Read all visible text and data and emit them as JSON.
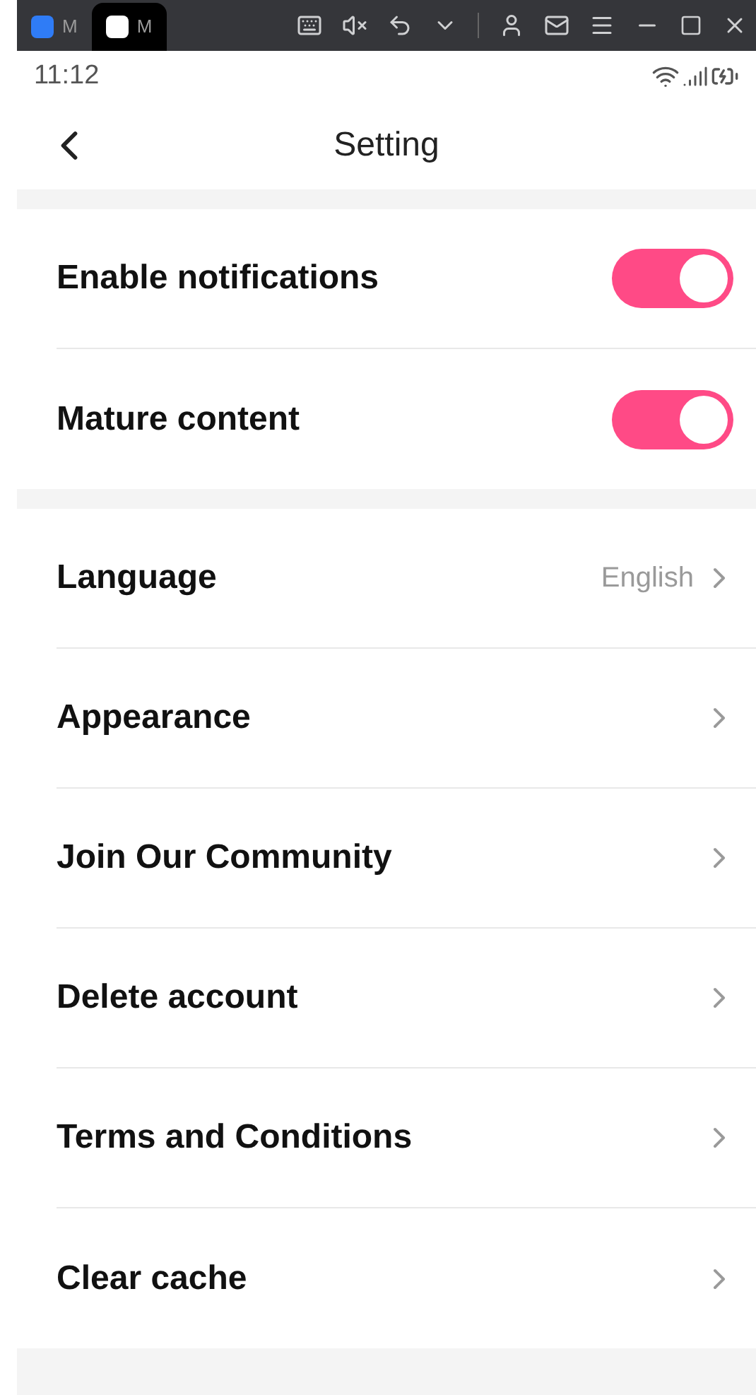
{
  "window_tabs": [
    {
      "label": "M",
      "selected": false
    },
    {
      "label": "M",
      "selected": true
    }
  ],
  "status_bar": {
    "time": "11:12"
  },
  "header": {
    "title": "Setting"
  },
  "toggles": [
    {
      "label": "Enable notifications",
      "on": true
    },
    {
      "label": "Mature content",
      "on": true
    }
  ],
  "links": [
    {
      "label": "Language",
      "value": "English"
    },
    {
      "label": "Appearance"
    },
    {
      "label": "Join Our Community"
    },
    {
      "label": "Delete account"
    },
    {
      "label": "Terms and Conditions"
    },
    {
      "label": "Clear cache"
    }
  ]
}
